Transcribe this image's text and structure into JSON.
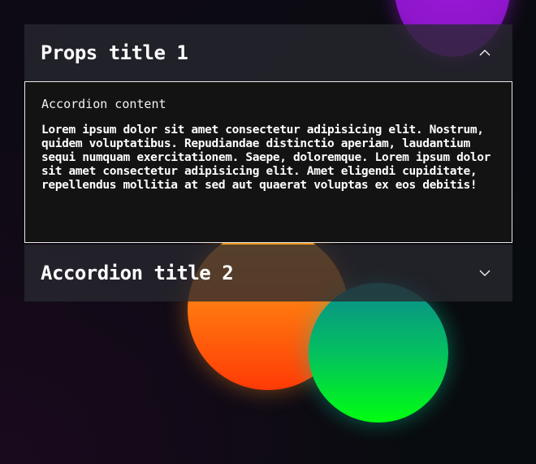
{
  "accordion": {
    "items": [
      {
        "title": "Props title 1",
        "expanded": true,
        "icon": "chevron-up-icon",
        "content_heading": "Accordion content",
        "content_body": "Lorem ipsum dolor sit amet consectetur adipisicing elit. Nostrum, quidem voluptatibus. Repudiandae distinctio aperiam, laudantium sequi numquam exercitationem. Saepe, doloremque. Lorem ipsum dolor sit amet consectetur adipisicing elit. Amet eligendi cupiditate, repellendus mollitia at sed aut quaerat voluptas ex eos debitis!"
      },
      {
        "title": "Accordion title 2",
        "expanded": false,
        "icon": "chevron-down-icon"
      }
    ]
  },
  "colors": {
    "header_bg": "#28282f",
    "panel_bg": "#131313",
    "panel_border": "#e8e8e8",
    "blob_purple": "#9a16d0",
    "blob_orange": "#ff7a10",
    "blob_green": "#04c060"
  }
}
